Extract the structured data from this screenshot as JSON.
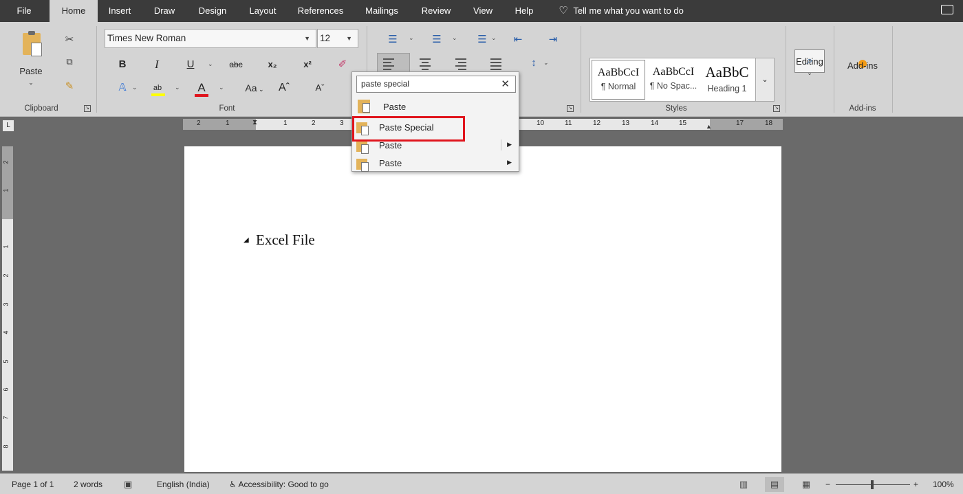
{
  "tabs": [
    "File",
    "Home",
    "Insert",
    "Draw",
    "Design",
    "Layout",
    "References",
    "Mailings",
    "Review",
    "View",
    "Help"
  ],
  "tell_me": "Tell me what you want to do",
  "clipboard": {
    "paste_label": "Paste",
    "group_label": "Clipboard"
  },
  "font": {
    "name": "Times New Roman",
    "size": "12",
    "group_label": "Font",
    "change_case": "Aa",
    "bold": "B",
    "italic": "I",
    "underline": "U",
    "strike": "abc",
    "subscript": "x₂",
    "superscript": "x²",
    "grow": "Aˆ",
    "shrink": "Aˇ",
    "color_letter": "A",
    "highlight_letter": "ab"
  },
  "styles": {
    "group_label": "Styles",
    "items": [
      {
        "sample": "AaBbCcI",
        "name": "¶ Normal"
      },
      {
        "sample": "AaBbCcI",
        "name": "¶ No Spac..."
      },
      {
        "sample": "AaBbC",
        "name": "Heading 1"
      }
    ]
  },
  "editing": {
    "label": "Editing"
  },
  "addins": {
    "label": "Add-ins",
    "group_label": "Add-ins"
  },
  "ruler_h": [
    "2",
    "1",
    "1",
    "2",
    "3",
    "10",
    "11",
    "12",
    "13",
    "14",
    "15",
    "17",
    "18"
  ],
  "ruler_v": [
    "2",
    "1",
    "1",
    "2",
    "3",
    "4",
    "5",
    "6",
    "7",
    "8"
  ],
  "document": {
    "heading": "Excel File"
  },
  "search": {
    "query": "paste special",
    "results": [
      {
        "label": "Paste",
        "submenu": false
      },
      {
        "label": "Paste Special",
        "submenu": false
      },
      {
        "label": "Paste",
        "submenu": true
      },
      {
        "label": "Paste",
        "submenu": true
      }
    ]
  },
  "status": {
    "page": "Page 1 of 1",
    "words": "2 words",
    "language": "English (India)",
    "accessibility": "Accessibility: Good to go",
    "zoom": "100%",
    "zoom_minus": "−",
    "zoom_plus": "+"
  },
  "colors": {
    "highlight": "#e0141c",
    "font_color": "#e0141c",
    "text_highlight": "#ffff00"
  }
}
